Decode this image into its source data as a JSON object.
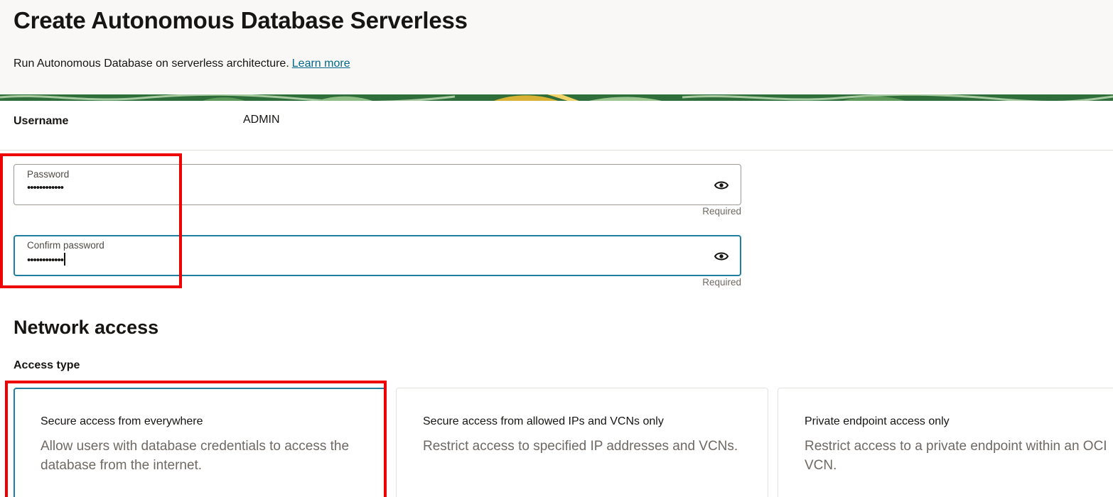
{
  "header": {
    "title": "Create Autonomous Database Serverless",
    "subtitle": "Run Autonomous Database on serverless architecture.",
    "learn_more": "Learn more"
  },
  "credentials": {
    "username_label": "Username",
    "username_value": "ADMIN",
    "password": {
      "label": "Password",
      "value": "••••••••••••",
      "hint": "Required",
      "icon": "eye-icon"
    },
    "confirm_password": {
      "label": "Confirm password",
      "value": "••••••••••••",
      "hint": "Required",
      "icon": "eye-icon"
    }
  },
  "network": {
    "title": "Network access",
    "access_type_label": "Access type",
    "options": [
      {
        "title": "Secure access from everywhere",
        "description": "Allow users with database credentials to access the database from the internet.",
        "selected": true
      },
      {
        "title": "Secure access from allowed IPs and VCNs only",
        "description": "Restrict access to specified IP addresses and VCNs.",
        "selected": false
      },
      {
        "title": "Private endpoint access only",
        "description": "Restrict access to a private endpoint within an OCI VCN.",
        "selected": false
      }
    ]
  },
  "colors": {
    "accent": "#227e9e",
    "link": "#00688c",
    "annotation": "#ee0000",
    "banner_green": "#2f6e3a",
    "banner_gold": "#d8b234"
  }
}
